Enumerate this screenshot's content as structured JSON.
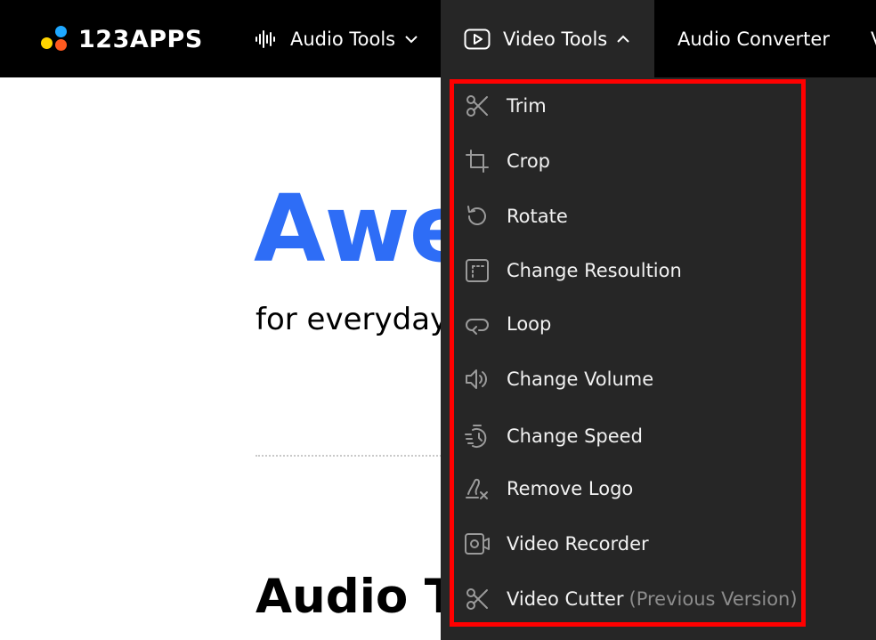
{
  "brand": {
    "name": "123APPS"
  },
  "nav": {
    "audio_tools": "Audio Tools",
    "video_tools": "Video Tools",
    "audio_converter": "Audio Converter",
    "cut_off": "V"
  },
  "hero": {
    "title": "Awe",
    "subtitle": "for everyday"
  },
  "section": {
    "title": "Audio To"
  },
  "dropdown": {
    "items": [
      {
        "label": "Trim",
        "icon": "scissors-icon"
      },
      {
        "label": "Crop",
        "icon": "crop-icon"
      },
      {
        "label": "Rotate",
        "icon": "rotate-icon"
      },
      {
        "label": "Change Resoultion",
        "icon": "resolution-icon"
      },
      {
        "label": "Loop",
        "icon": "loop-icon"
      },
      {
        "label": "Change Volume",
        "icon": "volume-icon"
      },
      {
        "label": "Change Speed",
        "icon": "speed-icon"
      },
      {
        "label": "Remove Logo",
        "icon": "remove-logo-icon"
      },
      {
        "label": "Video Recorder",
        "icon": "video-recorder-icon"
      },
      {
        "label": "Video Cutter",
        "note": "(Previous Version)",
        "icon": "scissors-icon"
      }
    ]
  },
  "colors": {
    "accent": "#2e6df6",
    "highlight": "#ff0000",
    "menu_bg": "#262626",
    "topbar_bg": "#000000"
  }
}
